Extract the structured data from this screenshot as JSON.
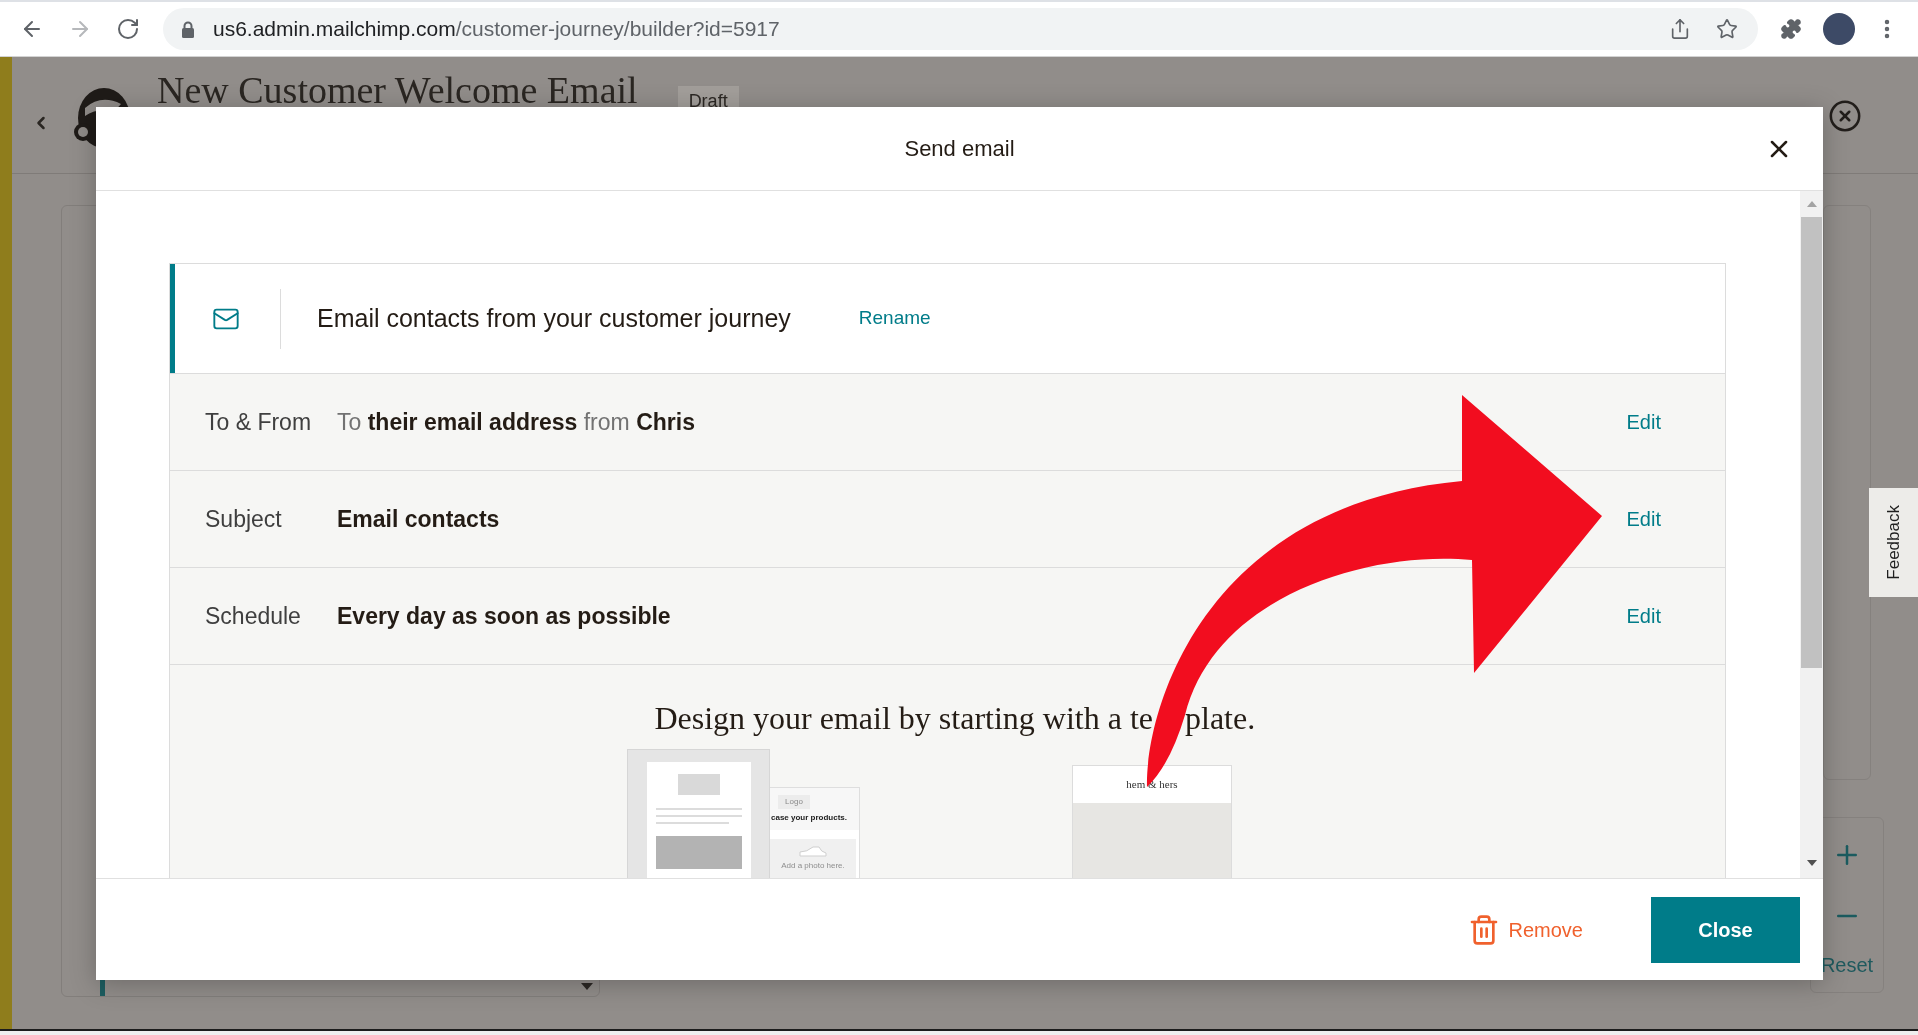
{
  "browser": {
    "nav_buttons": [
      {
        "kind": "back",
        "disabled": false
      },
      {
        "kind": "forward",
        "disabled": true
      },
      {
        "kind": "reload",
        "disabled": false
      }
    ],
    "address": {
      "host": "us6.admin.mailchimp.com",
      "path": "/customer-journey/builder?id=5917"
    }
  },
  "page": {
    "title": "New Customer Welcome Email",
    "status_badge": "Draft",
    "zoom_controls": {
      "reset": "Reset"
    },
    "feedback_tab": "Feedback"
  },
  "modal": {
    "title": "Send email",
    "step": {
      "title": "Email contacts from your customer journey",
      "rename_link": "Rename"
    },
    "rows": [
      {
        "kind": "recipients",
        "label": "To & From",
        "value": "To **their email address** from **Chris**",
        "action": "Edit"
      },
      {
        "kind": "text",
        "label": "Subject",
        "value": "Email contacts",
        "action": "Edit"
      },
      {
        "kind": "text",
        "label": "Schedule",
        "value": "Every day as soon as possible",
        "action": "Edit"
      }
    ],
    "templates": {
      "heading_start": "Design your email by starting with a te",
      "heading_end": "plate.",
      "previews": [
        {
          "kind": "basic"
        },
        {
          "kind": "product",
          "logo": "Logo",
          "headline": "case your products.",
          "photo_hint": "Add a photo here."
        },
        {
          "kind": "brand",
          "brand": "hem & hers"
        }
      ]
    },
    "footer": {
      "remove_button": "Remove",
      "close_button": "Close"
    }
  }
}
